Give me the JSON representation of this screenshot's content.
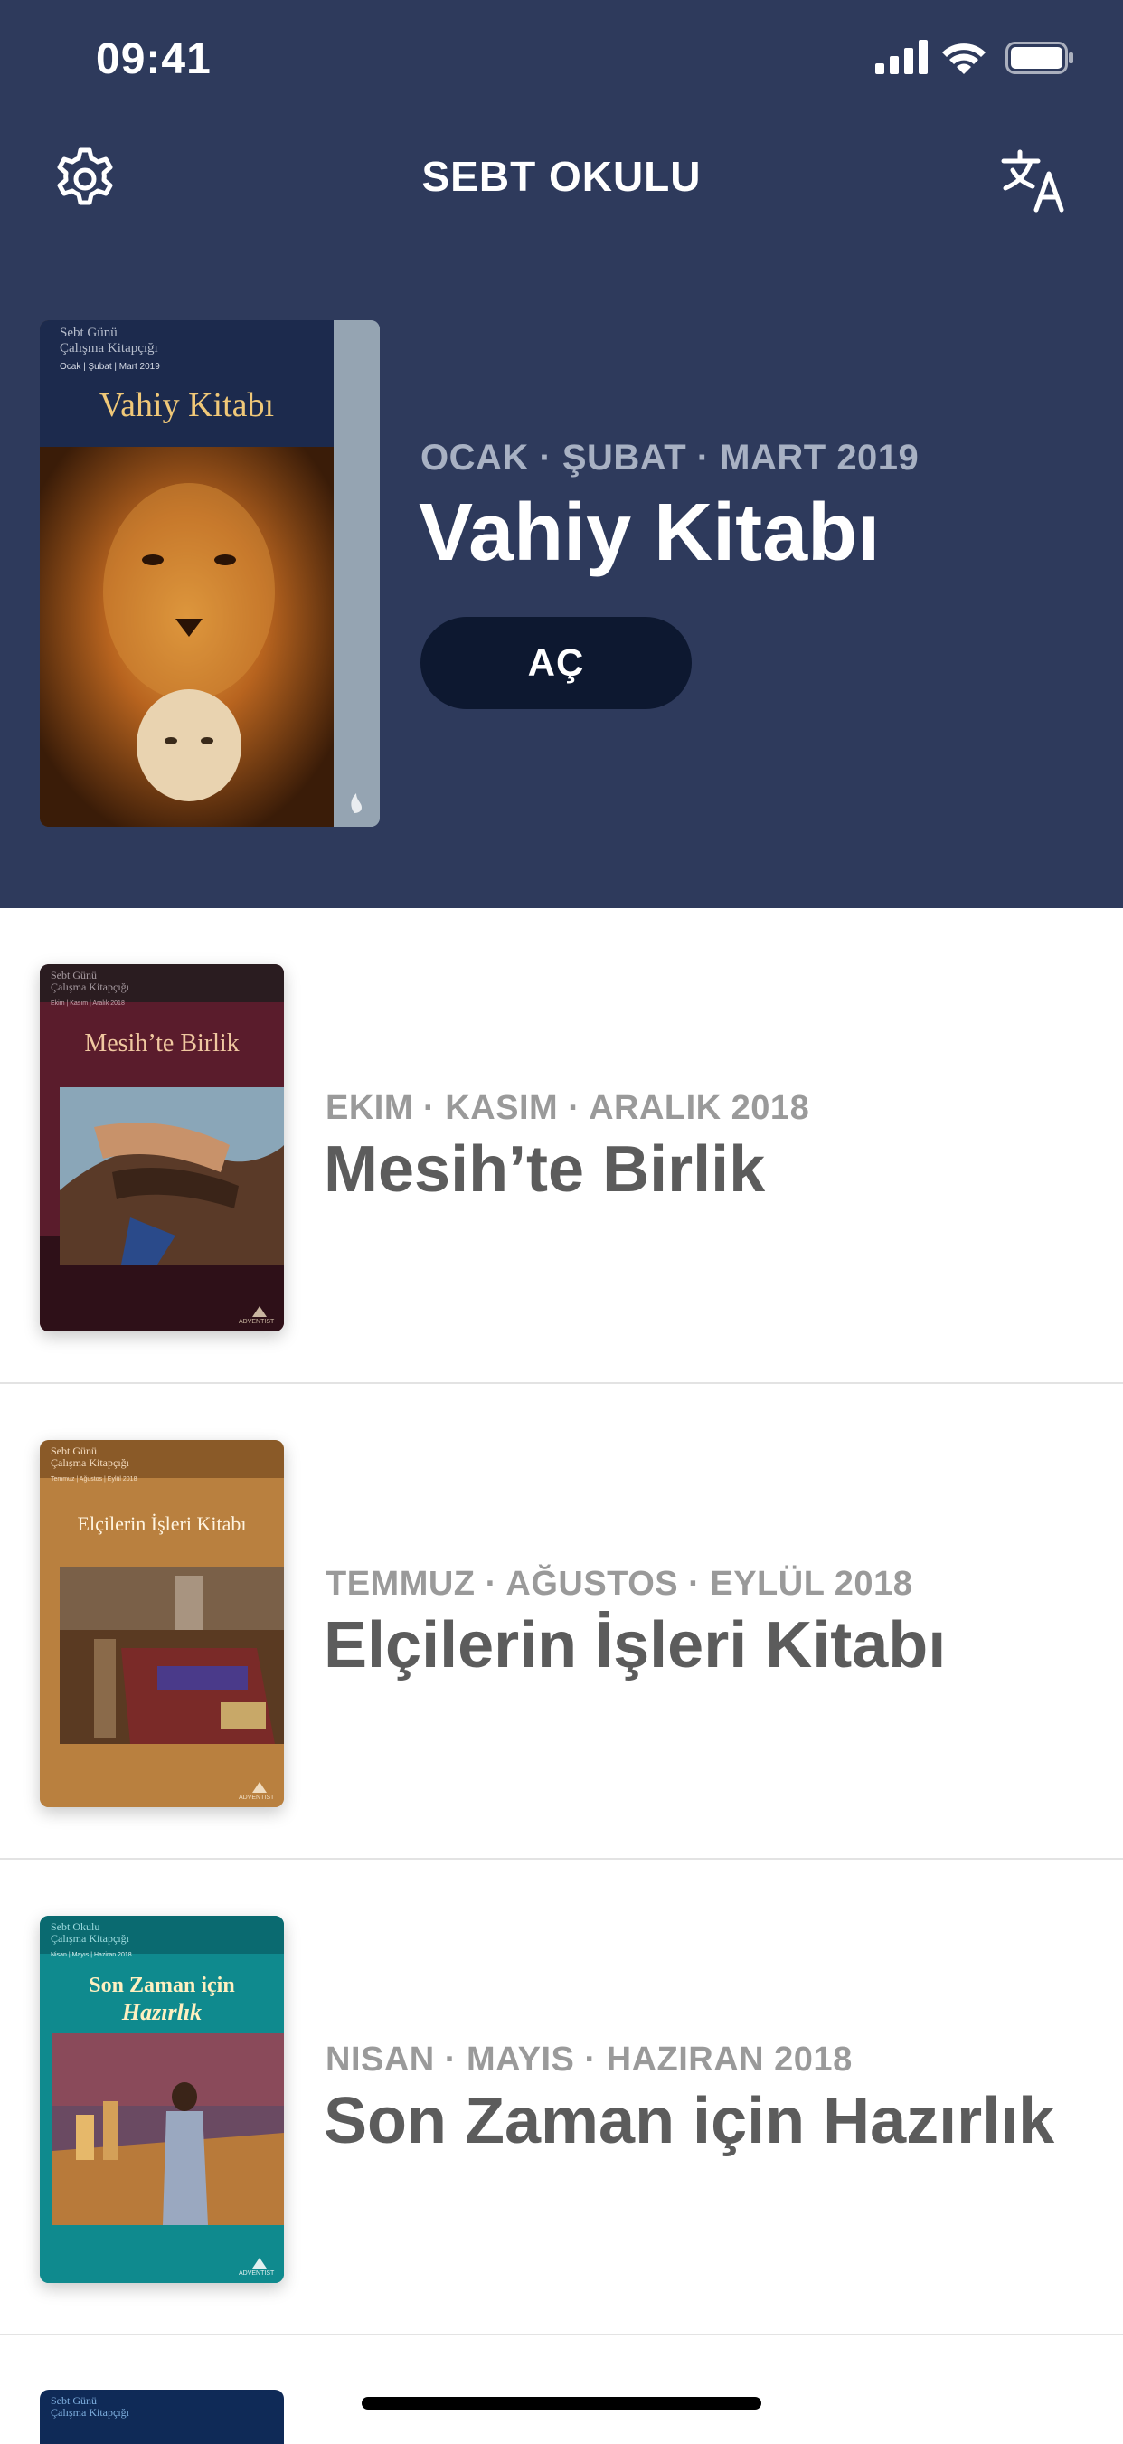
{
  "status": {
    "time": "09:41"
  },
  "nav": {
    "title": "SEBT OKULU",
    "settings_icon": "gear-icon",
    "language_icon": "translate-icon"
  },
  "hero": {
    "period": "OCAK · ŞUBAT · MART 2019",
    "title": "Vahiy Kitabı",
    "open_label": "AÇ",
    "cover": {
      "series": "Sebt Günü\nÇalışma Kitapçığı",
      "dates": "Ocak | Şubat | Mart 2019",
      "title": "Vahiy Kitabı"
    },
    "colors": {
      "background": "#2e3a5c",
      "button": "#0d1830"
    }
  },
  "items": [
    {
      "period": "EKIM · KASIM · ARALIK 2018",
      "title": "Mesih’te Birlik",
      "cover": {
        "series": "Sebt Günü\nÇalışma Kitapçığı",
        "dates": "Ekim | Kasım | Aralık 2018",
        "title": "Mesih’te Birlik",
        "publisher": "ADVENTIST"
      }
    },
    {
      "period": "TEMMUZ · AĞUSTOS · EYLÜL 2018",
      "title": "Elçilerin İşleri Kitabı",
      "cover": {
        "series": "Sebt Günü\nÇalışma Kitapçığı",
        "dates": "Temmuz | Ağustos | Eylül 2018",
        "title": "Elçilerin İşleri Kitabı",
        "publisher": "ADVENTIST"
      }
    },
    {
      "period": "NISAN · MAYIS · HAZIRAN 2018",
      "title": "Son Zaman için Hazırlık",
      "cover": {
        "series": "Sebt Okulu\nÇalışma Kitapçığı",
        "dates": "Nisan | Mayıs | Haziran 2018",
        "title_line1": "Son Zaman için",
        "title_line2": "Hazırlık",
        "publisher": "ADVENTIST"
      }
    }
  ],
  "peek": {
    "series": "Sebt Günü\nÇalışma Kitapçığı"
  }
}
